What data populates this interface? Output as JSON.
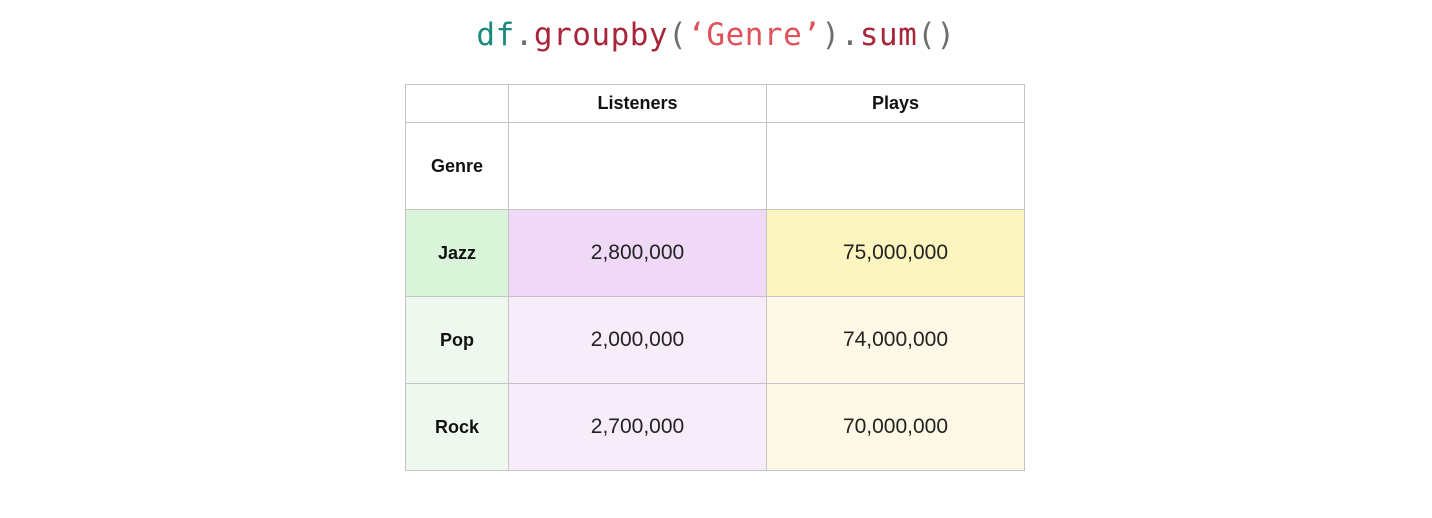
{
  "code": {
    "var": "df",
    "dot1": ".",
    "method1": "groupby",
    "paren_open1": "(",
    "string_arg": "‘Genre’",
    "paren_close1": ")",
    "dot2": ".",
    "method2": "sum",
    "parens2": "()"
  },
  "table": {
    "columns": [
      "Listeners",
      "Plays"
    ],
    "index_name": "Genre",
    "rows": [
      {
        "label": "Jazz",
        "values": [
          "2,800,000",
          "75,000,000"
        ],
        "highlighted": true
      },
      {
        "label": "Pop",
        "values": [
          "2,000,000",
          "74,000,000"
        ],
        "highlighted": false
      },
      {
        "label": "Rock",
        "values": [
          "2,700,000",
          "70,000,000"
        ],
        "highlighted": false
      }
    ]
  },
  "colors": {
    "index_highlight": "#d9f4d9",
    "index_normal": "#eef8ee",
    "listeners_highlight": "#f0d9f7",
    "listeners_normal": "#f7ecf9",
    "plays_highlight": "#fcf5c0",
    "plays_normal": "#fef9e6"
  }
}
